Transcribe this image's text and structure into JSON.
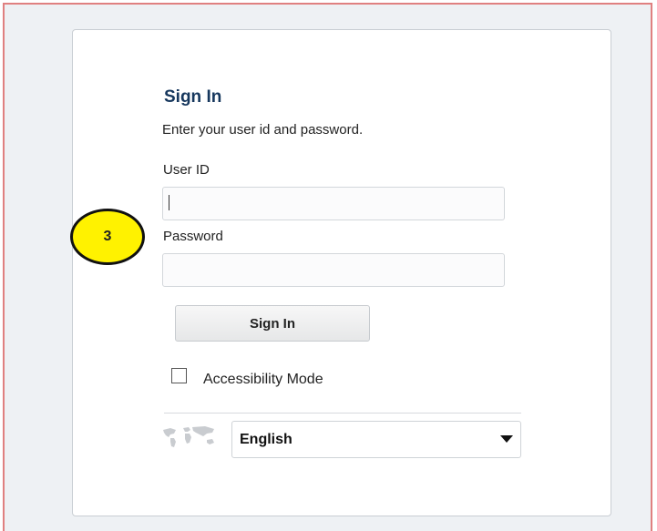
{
  "signin": {
    "title": "Sign In",
    "subtitle": "Enter your user id and password.",
    "userid_label": "User ID",
    "userid_value": "",
    "password_label": "Password",
    "password_value": "",
    "button_label": "Sign In",
    "accessibility_label": "Accessibility Mode",
    "language_selected": "English"
  },
  "annotation": {
    "step": "3",
    "color": "#fff200"
  },
  "icons": {
    "language": "world-map-icon",
    "dropdown": "caret-down-icon"
  }
}
